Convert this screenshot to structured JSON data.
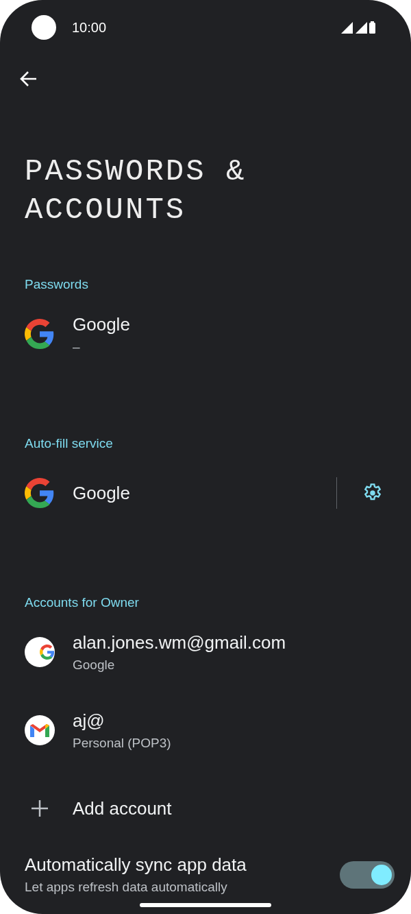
{
  "status_bar": {
    "time": "10:00"
  },
  "title": "PASSWORDS & ACCOUNTS",
  "sections": [
    {
      "header": "Passwords",
      "items": [
        {
          "kind": "app",
          "title": "Google",
          "subtitle": "–"
        }
      ]
    },
    {
      "header": "Auto-fill service",
      "items": [
        {
          "kind": "app_settings",
          "title": "Google"
        }
      ]
    },
    {
      "header": "Accounts for Owner",
      "items": [
        {
          "kind": "google_account",
          "title": "alan.jones.wm@gmail.com",
          "subtitle": "Google"
        },
        {
          "kind": "mail_account",
          "title": "aj@",
          "subtitle": "Personal (POP3)"
        },
        {
          "kind": "add",
          "title": "Add account"
        }
      ]
    }
  ],
  "sync": {
    "title": "Automatically sync app data",
    "subtitle": "Let apps refresh data automatically",
    "on": true
  }
}
